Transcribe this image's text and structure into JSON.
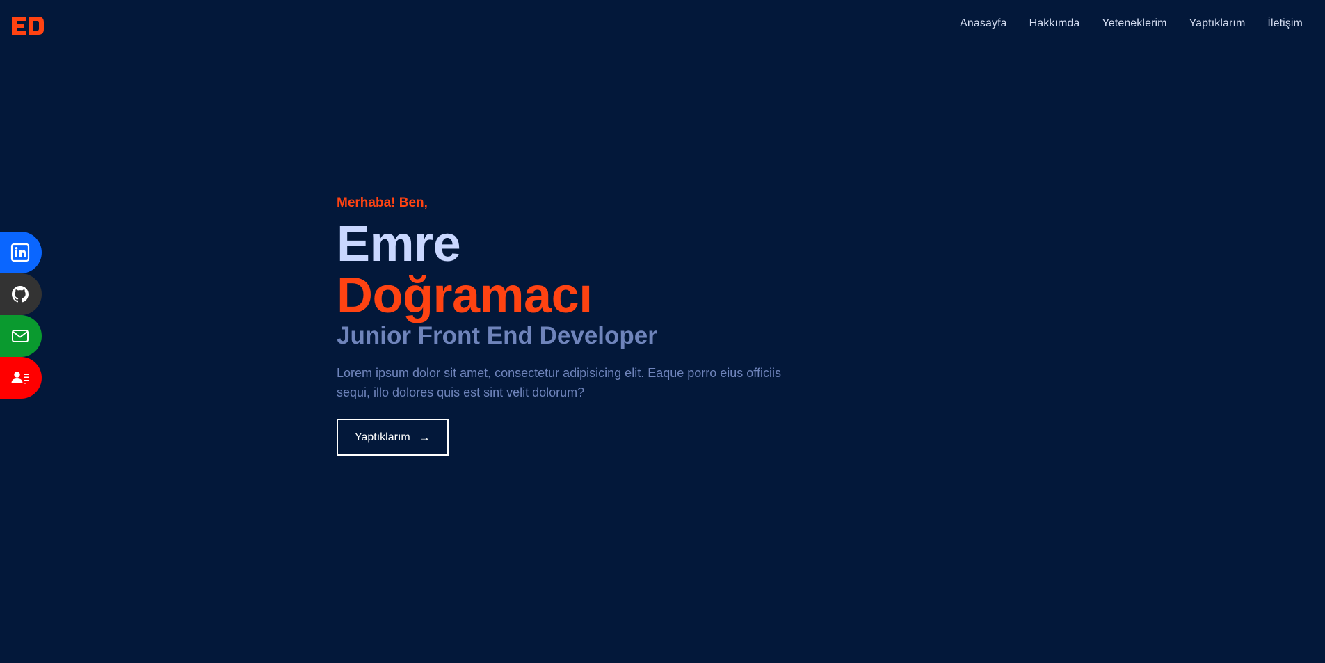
{
  "header": {
    "logo_text": "ED",
    "nav": [
      {
        "label": "Anasayfa"
      },
      {
        "label": "Hakkımda"
      },
      {
        "label": "Yeteneklerim"
      },
      {
        "label": "Yaptıklarım"
      },
      {
        "label": "İletişim"
      }
    ]
  },
  "social": [
    {
      "icon": "linkedin-icon",
      "color": "#0a66ff"
    },
    {
      "icon": "github-icon",
      "color": "#333333"
    },
    {
      "icon": "mail-icon",
      "color": "#0a9a2f"
    },
    {
      "icon": "contact-card-icon",
      "color": "#ff0000"
    }
  ],
  "hero": {
    "greeting": "Merhaba! Ben,",
    "first_name": "Emre",
    "last_name": "Doğramacı",
    "role": "Junior Front End Developer",
    "description": "Lorem ipsum dolor sit amet, consectetur adipisicing elit. Eaque porro eius officiis sequi, illo dolores quis est sint velit dolorum?",
    "cta_label": "Yaptıklarım",
    "cta_arrow": "→"
  },
  "colors": {
    "background": "#03183a",
    "accent": "#ff4312",
    "name_light": "#c9d7ff",
    "muted": "#6f84bb"
  }
}
